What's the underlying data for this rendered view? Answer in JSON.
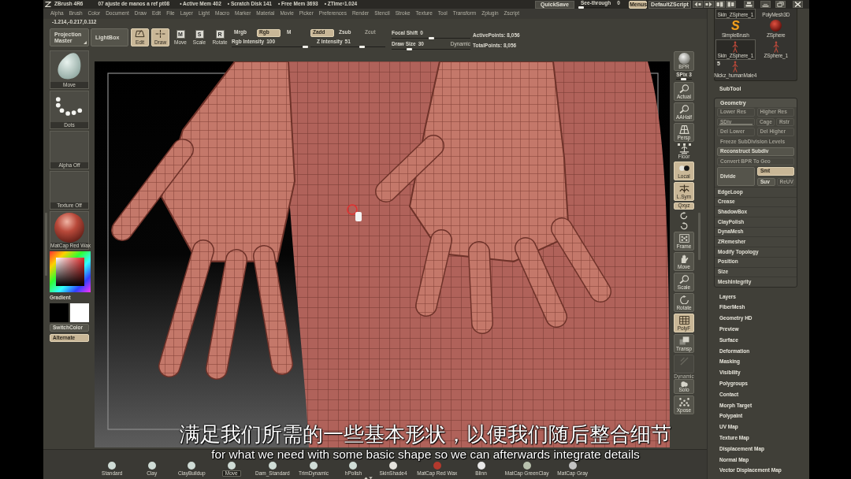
{
  "title_bar": {
    "app": "ZBrush 4R6",
    "document": "07 ajuste de manos a ref pt08",
    "stats": [
      "• Active Mem 402",
      "• Scratch Disk 141",
      "• Free Mem 3693",
      "• ZTime›1.024"
    ]
  },
  "top_controls": {
    "quicksave": "QuickSave",
    "see_through": {
      "label": "See-through",
      "reading": "0",
      "level": 0
    },
    "menus": {
      "label": "Menus",
      "on": true
    },
    "script": "DefaultZScript"
  },
  "menu_bar": [
    "Alpha",
    "Brush",
    "Color",
    "Document",
    "Draw",
    "Edit",
    "File",
    "Layer",
    "Light",
    "Macro",
    "Marker",
    "Material",
    "Movie",
    "Picker",
    "Preferences",
    "Render",
    "Stencil",
    "Stroke",
    "Texture",
    "Tool",
    "Transform",
    "Zplugin",
    "Zscript"
  ],
  "coordinates": "-1.214,-0.217,0.112",
  "toolbar": {
    "projection_master": "Projection Master",
    "lightbox": "LightBox",
    "modes": [
      {
        "label": "Edit",
        "selected": true
      },
      {
        "label": "Draw",
        "selected": true
      },
      {
        "label": "Move",
        "glyph": "M",
        "selected": false
      },
      {
        "label": "Scale",
        "glyph": "S",
        "selected": false
      },
      {
        "label": "Rotate",
        "glyph": "R",
        "selected": false
      }
    ],
    "color_modes": [
      {
        "label": "Mrgb",
        "selected": false
      },
      {
        "label": "Rgb",
        "selected": true
      },
      {
        "label": "M",
        "selected": false
      }
    ],
    "z_modes": [
      {
        "label": "Zadd",
        "selected": true,
        "disabled": false
      },
      {
        "label": "Zsub",
        "selected": false,
        "disabled": false
      },
      {
        "label": "Zcut",
        "selected": false,
        "disabled": true
      }
    ],
    "rgb_intensity": {
      "label": "Rgb Intensity",
      "reading": "100",
      "level": 1
    },
    "z_intensity": {
      "label": "Z Intensity",
      "reading": "51",
      "level": 0.7
    },
    "focal_shift": {
      "label": "Focal Shift",
      "reading": "0",
      "level": 0.5
    },
    "draw_size": {
      "label": "Draw Size",
      "reading": "30",
      "level": 0.2
    },
    "dynamic": "Dynamic",
    "points": [
      "ActivePoints: 8,056",
      "TotalPoints: 8,056"
    ]
  },
  "left_shelf": {
    "thumbs": [
      {
        "kind": "brush",
        "label": "Move"
      },
      {
        "kind": "stroke",
        "label": "Dots"
      },
      {
        "kind": "empty",
        "label": "Alpha Off"
      },
      {
        "kind": "empty",
        "label": "Texture Off"
      },
      {
        "kind": "material",
        "label": "MatCap Red Wax"
      }
    ],
    "gradient": "Gradient",
    "swatches": [
      {
        "color": "#000000"
      },
      {
        "color": "#ffffff"
      }
    ],
    "buttons": [
      {
        "label": "SwitchColor",
        "on": false
      },
      {
        "label": "Alternate",
        "on": true
      }
    ]
  },
  "right_shelf": {
    "render": "BPR",
    "spix": {
      "label": "SPix 3",
      "level": 0.45
    },
    "buttons": [
      {
        "kind": "button",
        "label": "Actual",
        "on": false,
        "disabled": false
      },
      {
        "kind": "button",
        "label": "AAHalf",
        "on": false,
        "disabled": false
      },
      {
        "kind": "button",
        "label": "Persp",
        "on": false,
        "disabled": false
      },
      {
        "kind": "plain",
        "label": "Floor",
        "on": false,
        "disabled": false
      },
      {
        "kind": "button",
        "label": "Local",
        "on": true,
        "disabled": false
      },
      {
        "kind": "button",
        "label": "L.Sym",
        "on": true,
        "disabled": false
      },
      {
        "kind": "small",
        "label": "Qxyz",
        "on": true,
        "disabled": false
      },
      {
        "kind": "button",
        "label": "Frame",
        "on": false,
        "disabled": false
      },
      {
        "kind": "button",
        "label": "Move",
        "on": false,
        "disabled": false
      },
      {
        "kind": "button",
        "label": "Scale",
        "on": false,
        "disabled": false
      },
      {
        "kind": "button",
        "label": "Rotate",
        "on": false,
        "disabled": false
      },
      {
        "kind": "button",
        "label": "PolyF",
        "on": true,
        "disabled": false
      },
      {
        "kind": "button",
        "label": "Transp",
        "on": false,
        "disabled": false
      },
      {
        "kind": "button",
        "on": false,
        "disabled": true
      },
      {
        "kind": "button",
        "caption": "Dynamic",
        "label": "Solo",
        "on": false,
        "disabled": false
      },
      {
        "kind": "button",
        "label": "Xpose",
        "on": false,
        "disabled": false
      }
    ]
  },
  "tool_thumbnails": [
    {
      "kind": "cut",
      "label": "Skin_ZSphere_1",
      "selected": true
    },
    {
      "kind": "cut",
      "label": "PolyMesh3D",
      "selected": false
    },
    {
      "kind": "brush",
      "glyph": "S",
      "label": "SimpleBrush",
      "selected": false
    },
    {
      "kind": "sphere",
      "label": "ZSphere",
      "selected": false
    },
    {
      "kind": "figure",
      "label": "Skin_ZSphere_1",
      "selected": true
    },
    {
      "kind": "figure",
      "label": "ZSphere_1",
      "selected": false
    },
    {
      "kind": "figure",
      "badge": "5",
      "label": "Nickz_humanMale4",
      "selected": false
    }
  ],
  "subtool": "SubTool",
  "geometry": {
    "title": "Geometry",
    "buttons": [
      {
        "kind": "button",
        "label": "Lower Res",
        "on": false,
        "disabled": true
      },
      {
        "kind": "button",
        "label": "Higher Res",
        "on": false,
        "disabled": true
      },
      {
        "kind": "slider",
        "label": "SDiv",
        "disabled": true
      },
      {
        "kind": "button",
        "label": "Cage",
        "on": false,
        "disabled": true
      },
      {
        "kind": "button",
        "label": "Rstr",
        "on": false,
        "disabled": true
      },
      {
        "kind": "button",
        "label": "Del Lower",
        "on": false,
        "disabled": true
      },
      {
        "kind": "button",
        "label": "Del Higher",
        "on": false,
        "disabled": true
      },
      {
        "kind": "plain",
        "label": "Freeze SubDivision Levels",
        "on": false,
        "disabled": true
      },
      {
        "kind": "button",
        "label": "Reconstruct Subdiv",
        "on": false,
        "disabled": false
      },
      {
        "kind": "button",
        "label": "Convert BPR To Geo",
        "on": false,
        "disabled": true
      },
      {
        "kind": "button",
        "label": "Divide",
        "on": false,
        "disabled": false
      },
      {
        "kind": "button",
        "label": "Smt",
        "on": true,
        "disabled": false
      },
      {
        "kind": "button",
        "label": "Suv",
        "on": false,
        "disabled": false
      },
      {
        "kind": "button",
        "label": "ReUV",
        "on": false,
        "disabled": true
      }
    ],
    "items": [
      "EdgeLoop",
      "Crease",
      "ShadowBox",
      "ClayPolish",
      "DynaMesh",
      "ZRemesher",
      "Modify Topology",
      "Position",
      "Size",
      "MeshIntegrity"
    ]
  },
  "subpalettes": [
    "Layers",
    "FiberMesh",
    "Geometry HD",
    "Preview",
    "Surface",
    "Deformation",
    "Masking",
    "Visibility",
    "Polygroups",
    "Contact",
    "Morph Target",
    "Polypaint",
    "UV Map",
    "Texture Map",
    "Displacement Map",
    "Normal Map",
    "Vector Displacement Map"
  ],
  "bottom_shelf": [
    {
      "label": "Standard",
      "color": "#cfdcd6",
      "selected": false
    },
    {
      "label": "Clay",
      "color": "#cfdcd6",
      "selected": false
    },
    {
      "label": "ClayBuildup",
      "color": "#cfdcd6",
      "selected": false
    },
    {
      "label": "Move",
      "color": "#cfdcd6",
      "selected": true
    },
    {
      "label": "Dam_Standard",
      "color": "#cfdcd6",
      "selected": false
    },
    {
      "label": "TrimDynamic",
      "color": "#cfdcd6",
      "selected": false
    },
    {
      "label": "hPolish",
      "color": "#cfdcd6",
      "selected": false
    },
    {
      "label": "SkinShade4",
      "color": "#e4e2dc",
      "selected": false
    },
    {
      "label": "MatCap Red Wax",
      "color": "#b3392d",
      "selected": false
    },
    {
      "label": "Blinn",
      "color": "#e8e8e8",
      "selected": false
    },
    {
      "label": "MatCap GreenClay",
      "color": "#b8c0ad",
      "selected": false
    },
    {
      "label": "MatCap Gray",
      "color": "#c2c2c2",
      "selected": false
    }
  ],
  "subtitles": [
    "满足我们所需的一些基本形状，以便我们随后整合细节",
    "for what we need with some basic shape so we can afterwards integrate details"
  ]
}
